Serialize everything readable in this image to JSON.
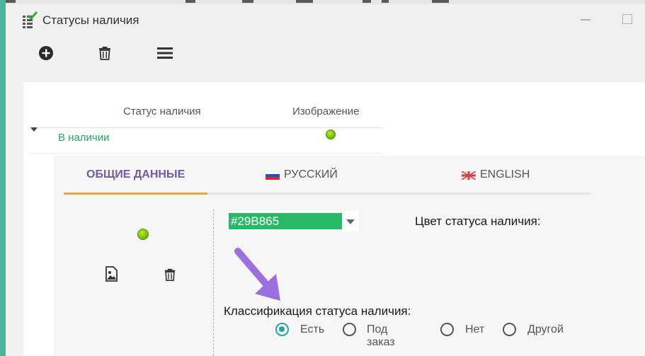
{
  "window": {
    "title": "Статусы наличия"
  },
  "toolbar": {
    "add_icon": "plus-circle-icon",
    "delete_icon": "trash-icon",
    "menu_icon": "hamburger-menu-icon"
  },
  "grid": {
    "columns": [
      "Статус наличия",
      "Изображение"
    ],
    "rows": [
      {
        "status": "В наличии",
        "image": "green-dot"
      }
    ]
  },
  "tabs": [
    {
      "label": "ОБЩИЕ ДАННЫЕ"
    },
    {
      "label": "РУССКИЙ"
    },
    {
      "label": "ENGLISH"
    }
  ],
  "form": {
    "color_value": "#29B865",
    "color_label": "Цвет статуса наличия:",
    "classification_label": "Классификация статуса наличия:",
    "options": [
      "Есть",
      "Под заказ",
      "Нет",
      "Другой"
    ],
    "selected_option": "Есть"
  },
  "colors": {
    "accent_green": "#29B865",
    "tab_active": "#6f5ba0",
    "tab_indicator": "#f0a53a",
    "radio_checked": "#26a69a",
    "status_text": "#29a55a",
    "arrow": "#9b6fe0"
  }
}
